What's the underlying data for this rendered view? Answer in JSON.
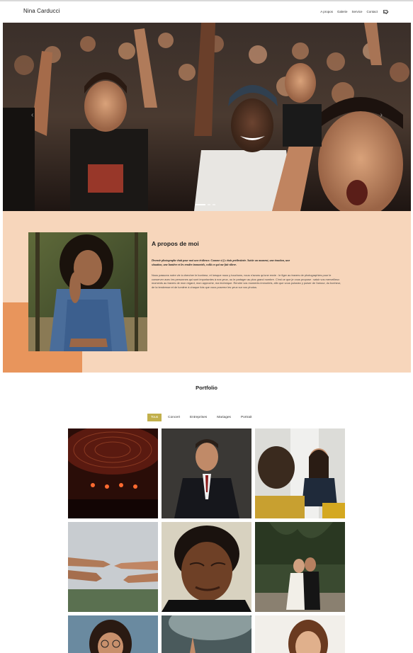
{
  "header": {
    "logo": "Nina Carducci",
    "nav": [
      "A propos",
      "Galerie",
      "Service",
      "Contact"
    ],
    "contact_icon": "instagram-icon"
  },
  "hero": {
    "image": "concert crowd cheering",
    "prev_icon": "chevron-left-icon",
    "next_icon": "chevron-right-icon",
    "prev": "‹",
    "next": "›",
    "slide_count": 3,
    "active_slide": 1
  },
  "about": {
    "title": "A propos de moi",
    "lead": "Devenir photographe était pour moi une évidence. Comme si j'y étais prédestinée. Saisir un moment, une émotion, une situation, une lumière et les rendre immortels, voilà ce qui me fait vibrer.",
    "body": "Nous passons notre vie à chercher le bonheur, et lorsque nous y touchons, nous n'avons qu'une envie : le figer au travers de photographies pour le conserver avec les personnes qui sont importantes à nos yeux, ou le partager au plus grand nombre. C'est ce que je vous propose : saisir vos merveilleux moments au travers de mon regard, mon approche, ma technique. Rendre vos moments immortels, afin que vous puissiez y puiser de l'amour, du bonheur, de la tendresse et de lumière à chaque fois que vous poserez les yeux sur vos photos.",
    "colors": {
      "background": "#f7d6bb",
      "accent": "#e8955c"
    }
  },
  "portfolio": {
    "title": "Portfolio",
    "filters": [
      "Tous",
      "Concert",
      "Entreprises",
      "Mariages",
      "Portrait"
    ],
    "active_filter": "Tous",
    "accent_color": "#c2b04c",
    "images": [
      "concert stage",
      "businessman in suit",
      "business meeting",
      "two hands reaching",
      "portrait man",
      "wedding couple",
      "woman with glasses",
      "concert hands",
      "smiling woman"
    ]
  }
}
